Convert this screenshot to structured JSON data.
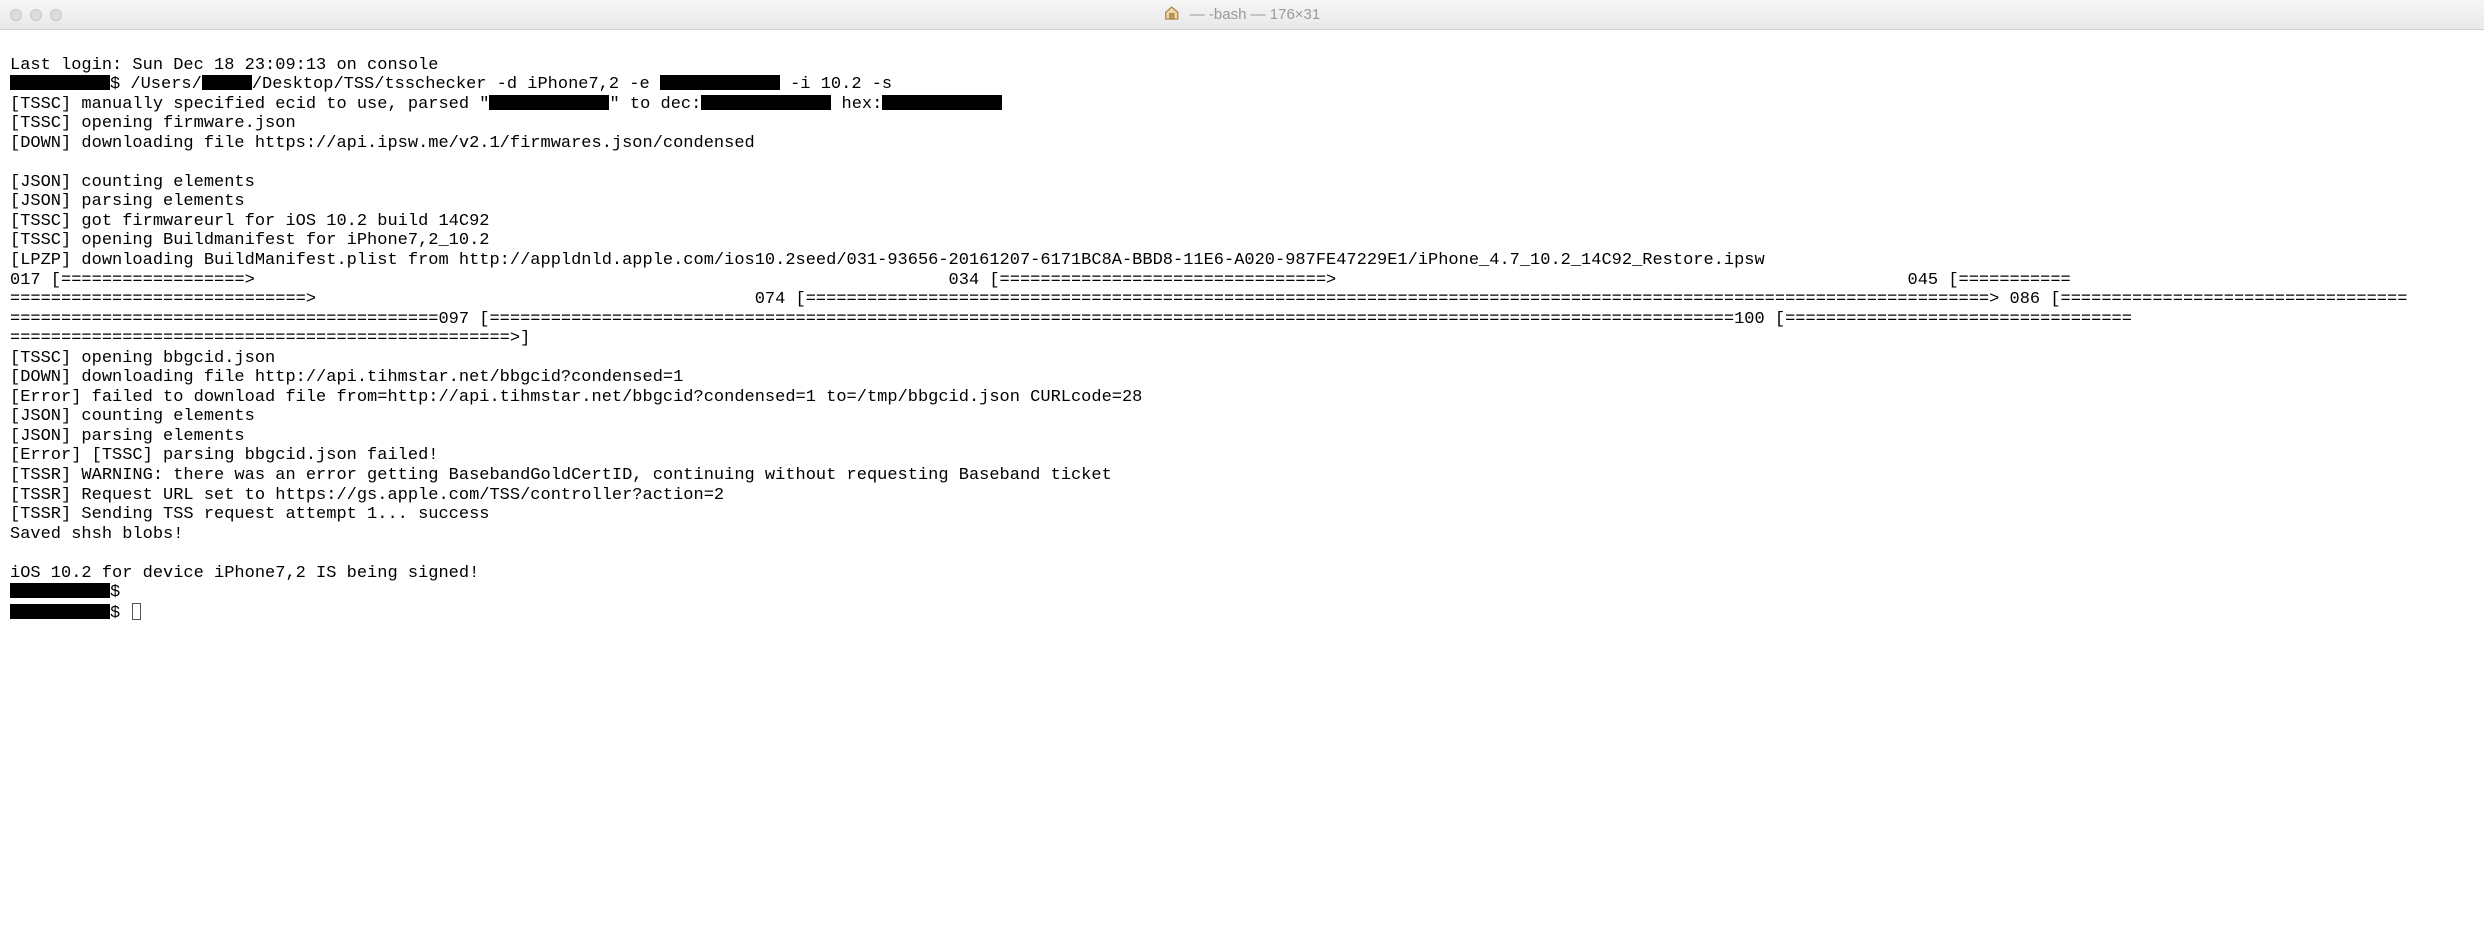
{
  "window": {
    "title": "— -bash — 176×31"
  },
  "lines": {
    "l0": "Last login: Sun Dec 18 23:09:13 on console",
    "l1a": "$ /Users/",
    "l1b": "/Desktop/TSS/tsschecker -d iPhone7,2 -e ",
    "l1c": " -i 10.2 -s",
    "l2a": "[TSSC] manually specified ecid to use, parsed \"",
    "l2b": "\" to dec:",
    "l2c": " hex:",
    "l3": "[TSSC] opening firmware.json",
    "l4": "[DOWN] downloading file https://api.ipsw.me/v2.1/firmwares.json/condensed",
    "l5": "",
    "l6": "[JSON] counting elements",
    "l7": "[JSON] parsing elements",
    "l8": "[TSSC] got firmwareurl for iOS 10.2 build 14C92",
    "l9": "[TSSC] opening Buildmanifest for iPhone7,2_10.2",
    "l10": "[LPZP] downloading BuildManifest.plist from http://appldnld.apple.com/ios10.2seed/031-93656-20161207-6171BC8A-BBD8-11E6-A020-987FE47229E1/iPhone_4.7_10.2_14C92_Restore.ipsw",
    "l11": "017 [==================>                                                                    034 [================================>                                                        045 [===========",
    "l12": "=============================>                                           074 [====================================================================================================================> 086 [==================================",
    "l13": "==========================================097 [==========================================================================================================================100 [==================================",
    "l14": "=================================================>]",
    "l15": "[TSSC] opening bbgcid.json",
    "l16": "[DOWN] downloading file http://api.tihmstar.net/bbgcid?condensed=1",
    "l17": "[Error] failed to download file from=http://api.tihmstar.net/bbgcid?condensed=1 to=/tmp/bbgcid.json CURLcode=28",
    "l18": "[JSON] counting elements",
    "l19": "[JSON] parsing elements",
    "l20": "[Error] [TSSC] parsing bbgcid.json failed!",
    "l21": "[TSSR] WARNING: there was an error getting BasebandGoldCertID, continuing without requesting Baseband ticket",
    "l22": "[TSSR] Request URL set to https://gs.apple.com/TSS/controller?action=2",
    "l23": "[TSSR] Sending TSS request attempt 1... success",
    "l24": "Saved shsh blobs!",
    "l25": "",
    "l26": "iOS 10.2 for device iPhone7,2 IS being signed!",
    "l27": "$ ",
    "l28": "$ "
  }
}
